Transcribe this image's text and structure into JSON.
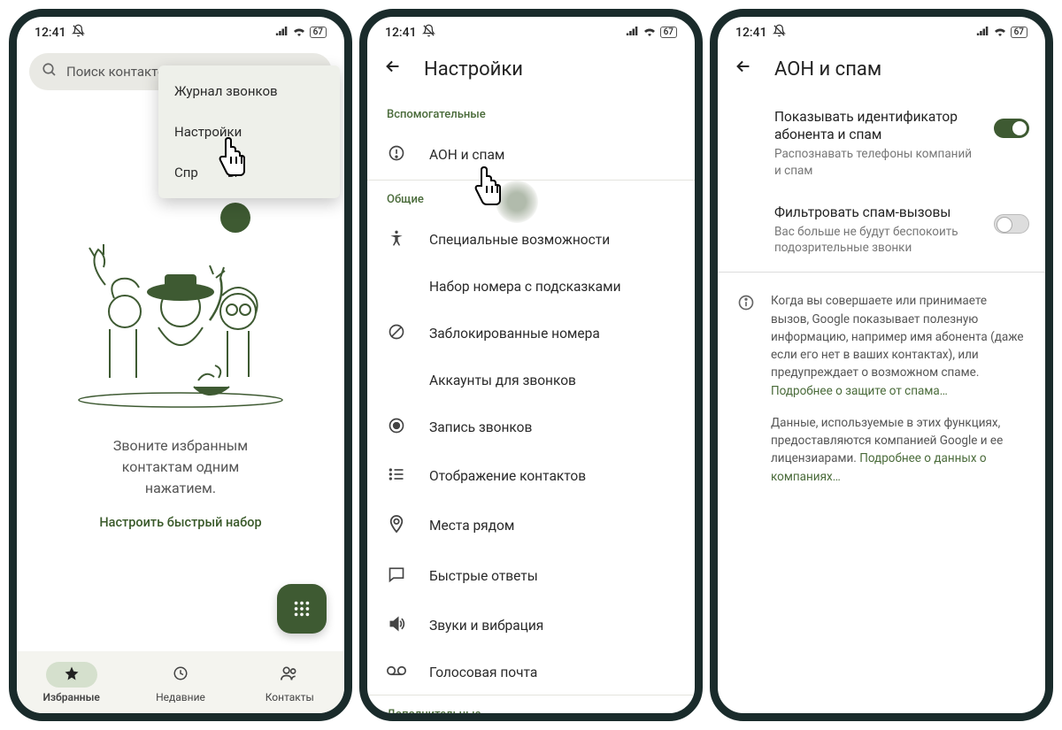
{
  "status": {
    "time": "12:41",
    "battery": "67"
  },
  "screen1": {
    "search_placeholder": "Поиск контактов",
    "menu": {
      "call_log": "Журнал звонков",
      "settings": "Настройки",
      "help": "Справка и отзывы"
    },
    "empty_line1": "Звоните избранным",
    "empty_line2": "контактам одним",
    "empty_line3": "нажатием.",
    "setup_link": "Настроить быстрый набор",
    "nav": {
      "favorites": "Избранные",
      "recent": "Недавние",
      "contacts": "Контакты"
    }
  },
  "screen2": {
    "title": "Настройки",
    "section_assist": "Вспомогательные",
    "caller_id_spam": "АОН и спам",
    "section_general": "Общие",
    "rows": {
      "accessibility": "Специальные возможности",
      "dial_assist": "Набор номера с подсказками",
      "blocked": "Заблокированные номера",
      "accounts": "Аккаунты для звонков",
      "recording": "Запись звонков",
      "display": "Отображение контактов",
      "nearby": "Места рядом",
      "quick_resp": "Быстрые ответы",
      "sounds": "Звуки и вибрация",
      "voicemail": "Голосовая почта"
    },
    "section_more": "Дополнительные"
  },
  "screen3": {
    "title": "АОН и спам",
    "toggle1": {
      "title": "Показывать идентификатор абонента и спам",
      "sub": "Распознавать телефоны компаний и спам"
    },
    "toggle2": {
      "title": "Фильтровать спам-вызовы",
      "sub": "Вас больше не будут беспокоить подозрительные звонки"
    },
    "info1": "Когда вы совершаете или принимаете вызов, Google показывает полезную информацию, например имя абонента (даже если его нет в ваших контактах), или предупреждает о возможном спаме.",
    "info1_link": "Подробнее о защите от спама…",
    "info2": "Данные, используемые в этих функциях, предоставляются компанией Google и ее лицензиарами.",
    "info2_link": "Подробнее о данных о компаниях…"
  }
}
